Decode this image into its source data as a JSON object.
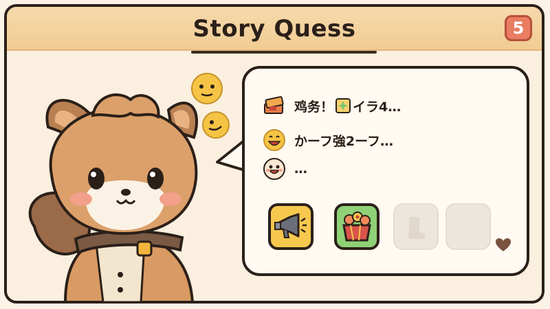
{
  "header": {
    "title": "Story Quess",
    "level_badge": "5"
  },
  "messages": [
    {
      "icon": "ticket-stack-icon",
      "text_before": "鸡务！",
      "inline_icon": "sparkle-card-icon",
      "text_after": "イラ4…"
    },
    {
      "icon": "grinning-face-icon",
      "text_before": "かーフ強2ーフ…"
    },
    {
      "icon": "smiling-face-icon",
      "text_before": "…"
    }
  ],
  "slots": [
    {
      "name": "megaphone-slot",
      "state": "filled",
      "icon": "megaphone-icon",
      "bg": "#f6c84e"
    },
    {
      "name": "gift-box-slot",
      "state": "filled",
      "icon": "flower-gift-box-icon",
      "bg": "#8fd177"
    },
    {
      "name": "empty-slot-1",
      "state": "empty"
    },
    {
      "name": "empty-slot-2",
      "state": "empty"
    }
  ],
  "colors": {
    "header_band": "#f1cc94",
    "panel_bg": "#fbf0df",
    "outline": "#2b2019",
    "badge": "#e97c61",
    "heart": "#7a5240"
  },
  "decor": {
    "floating_emojis": [
      "neutral-face-icon",
      "smirking-face-icon"
    ]
  }
}
